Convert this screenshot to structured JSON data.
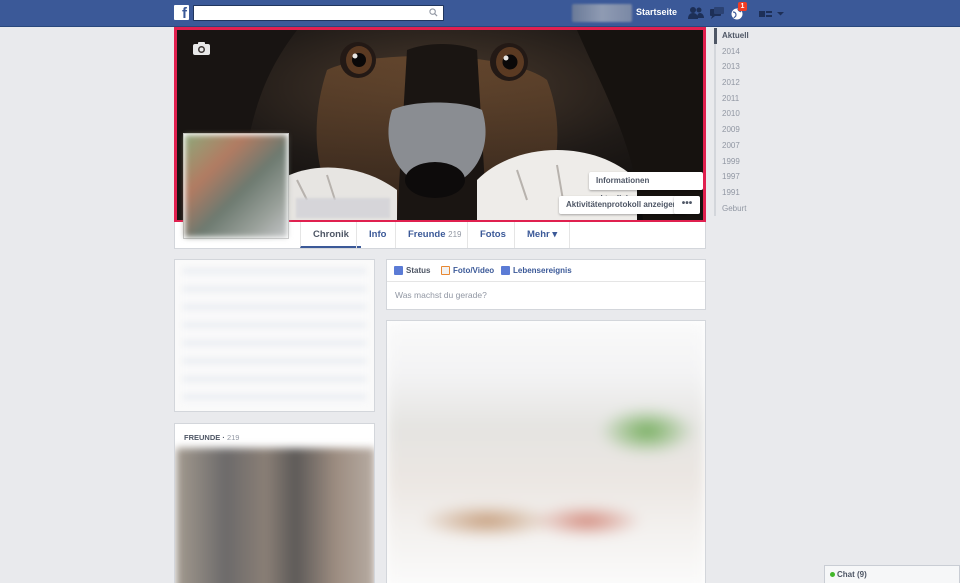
{
  "topbar": {
    "logo_letter": "f",
    "search_placeholder": "",
    "home_label": "Startseite",
    "notification_count": "1"
  },
  "cover": {
    "update_info_label": "Informationen aktualisieren",
    "activity_log_label": "Aktivitätenprotokoll anzeigen",
    "more_label": "•••"
  },
  "tabs": [
    {
      "label": "Chronik"
    },
    {
      "label": "Info"
    },
    {
      "label": "Freunde",
      "count": "219"
    },
    {
      "label": "Fotos"
    },
    {
      "label": "Mehr ▾"
    }
  ],
  "friends": {
    "label": "Freunde",
    "count": "219"
  },
  "composer": {
    "status_label": "Status",
    "photo_label": "Foto/Video",
    "event_label": "Lebensereignis",
    "prompt": "Was machst du gerade?"
  },
  "timeline": [
    "Aktuell",
    "2014",
    "2013",
    "2012",
    "2011",
    "2010",
    "2009",
    "2007",
    "1999",
    "1997",
    "1991",
    "Geburt"
  ],
  "chat": {
    "label": "Chat (9)"
  },
  "colors": {
    "brand": "#3b5998",
    "highlight": "#e0204f",
    "badge": "#f03d25"
  }
}
